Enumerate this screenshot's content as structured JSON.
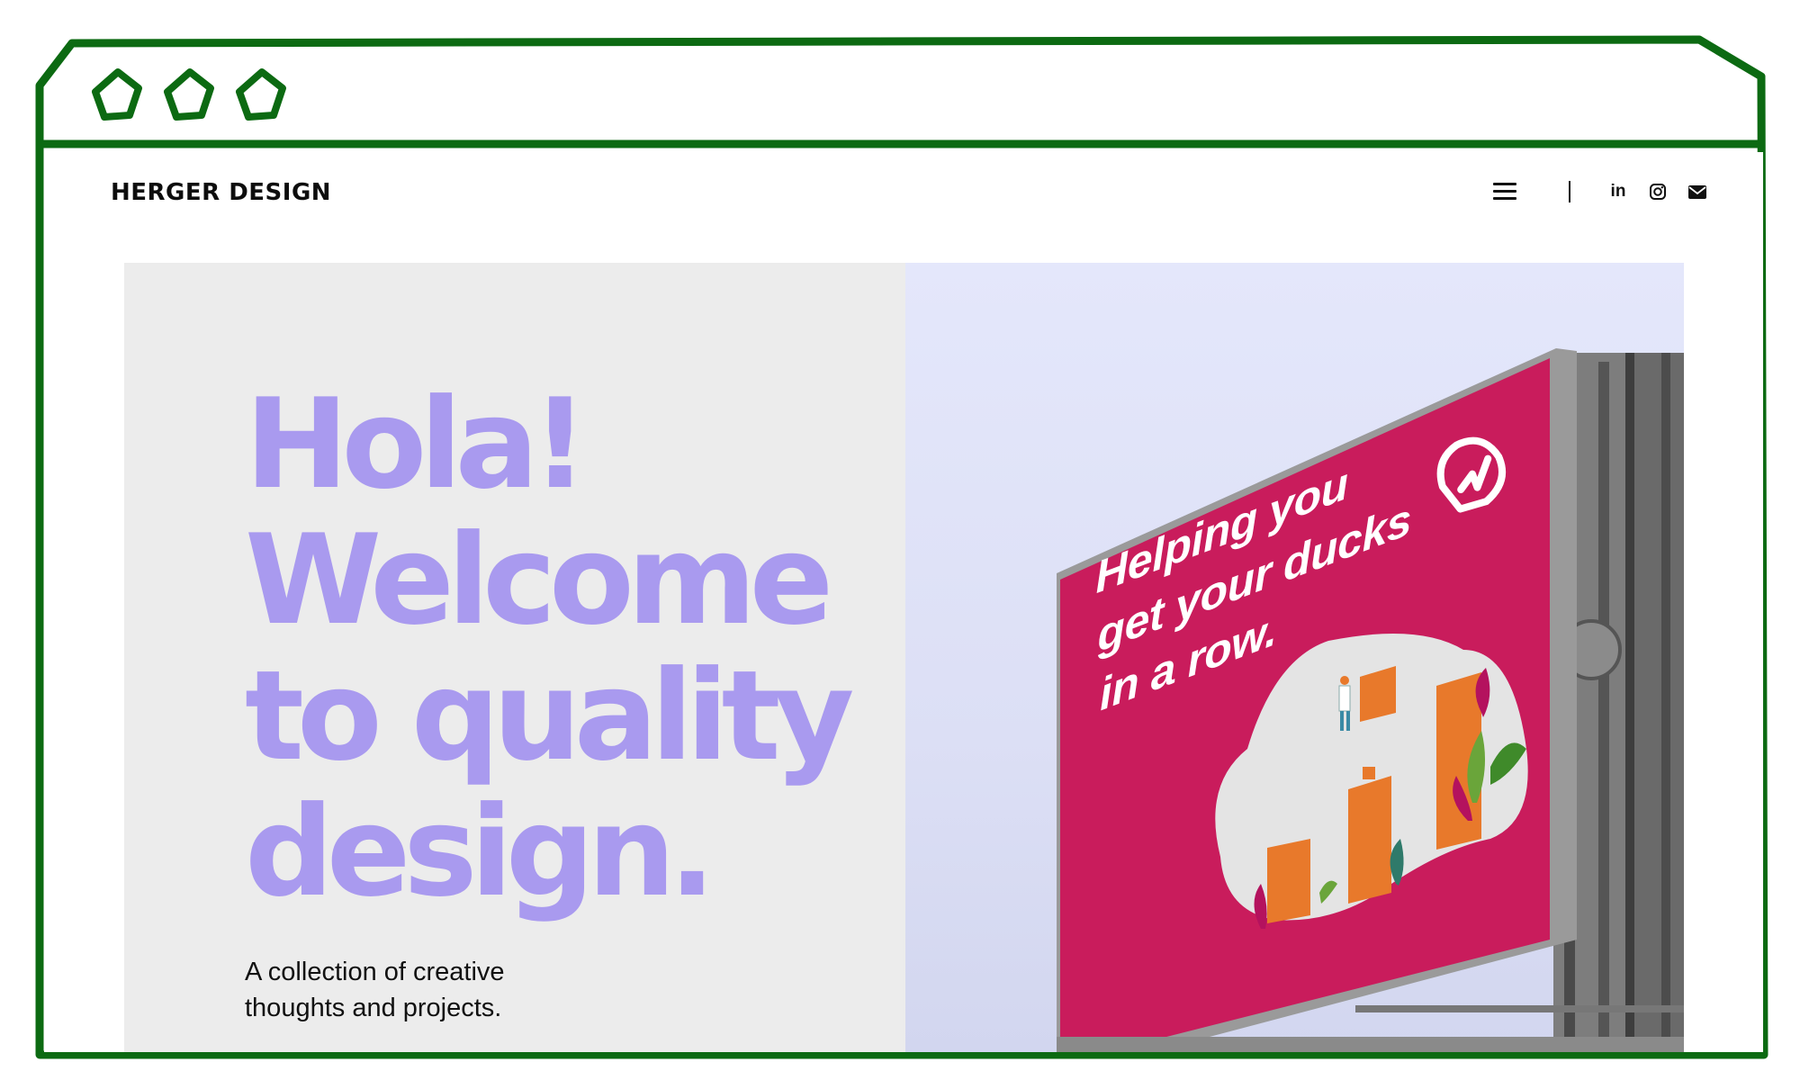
{
  "site": {
    "logo": "HERGER DESIGN"
  },
  "header": {
    "icons": [
      "menu-icon",
      "linkedin-icon",
      "instagram-icon",
      "email-icon"
    ],
    "linkedin_label": "in"
  },
  "hero": {
    "heading_lines": [
      "Hola!",
      "Welcome",
      "to quality",
      "design."
    ],
    "tagline_lines": [
      "A collection of creative",
      "thoughts and projects."
    ],
    "billboard_lines": [
      "Helping you",
      "get your ducks",
      "in a row."
    ]
  },
  "colors": {
    "frame": "#0c6a12",
    "heading": "#a99aef",
    "billboard": "#c91c5c",
    "bars": "#e8792b",
    "hero_left_bg": "#ececec",
    "sky": "#e2e5fa"
  }
}
